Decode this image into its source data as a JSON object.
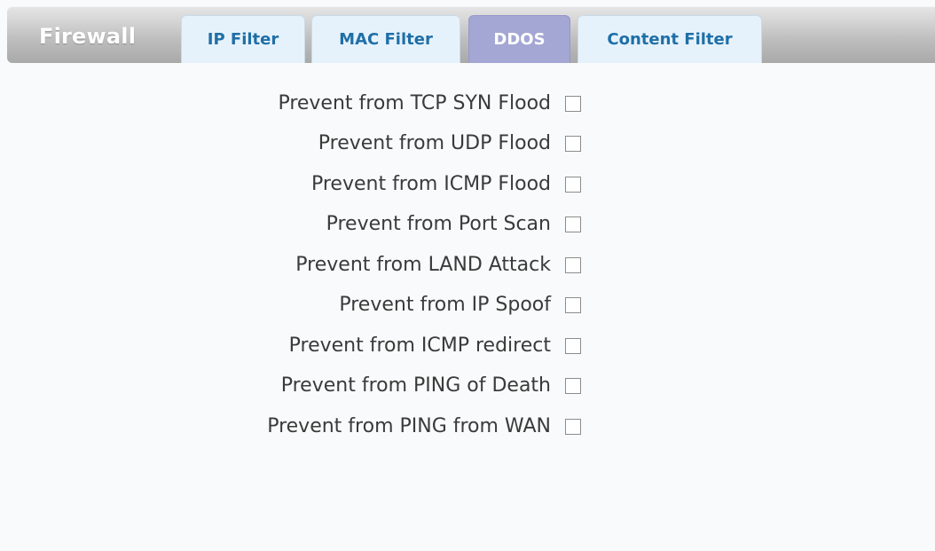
{
  "header": {
    "brand": "Firewall"
  },
  "tabs": [
    {
      "label": "IP Filter",
      "active": false
    },
    {
      "label": "MAC Filter",
      "active": false
    },
    {
      "label": "DDOS",
      "active": true
    },
    {
      "label": "Content Filter",
      "active": false
    }
  ],
  "colors": {
    "tab_active_bg": "#a4a6d4",
    "tab_inactive_bg": "#e6f2fb",
    "tab_inactive_text": "#1f6fa7",
    "label_text": "#3a3a3a"
  },
  "options": [
    {
      "label": "Prevent from TCP SYN Flood",
      "checked": false
    },
    {
      "label": "Prevent from UDP Flood",
      "checked": false
    },
    {
      "label": "Prevent from ICMP Flood",
      "checked": false
    },
    {
      "label": "Prevent from Port Scan",
      "checked": false
    },
    {
      "label": "Prevent from LAND Attack",
      "checked": false
    },
    {
      "label": "Prevent from IP Spoof",
      "checked": false
    },
    {
      "label": "Prevent from ICMP redirect",
      "checked": false
    },
    {
      "label": "Prevent from PING of Death",
      "checked": false
    },
    {
      "label": "Prevent from PING from WAN",
      "checked": false
    }
  ]
}
